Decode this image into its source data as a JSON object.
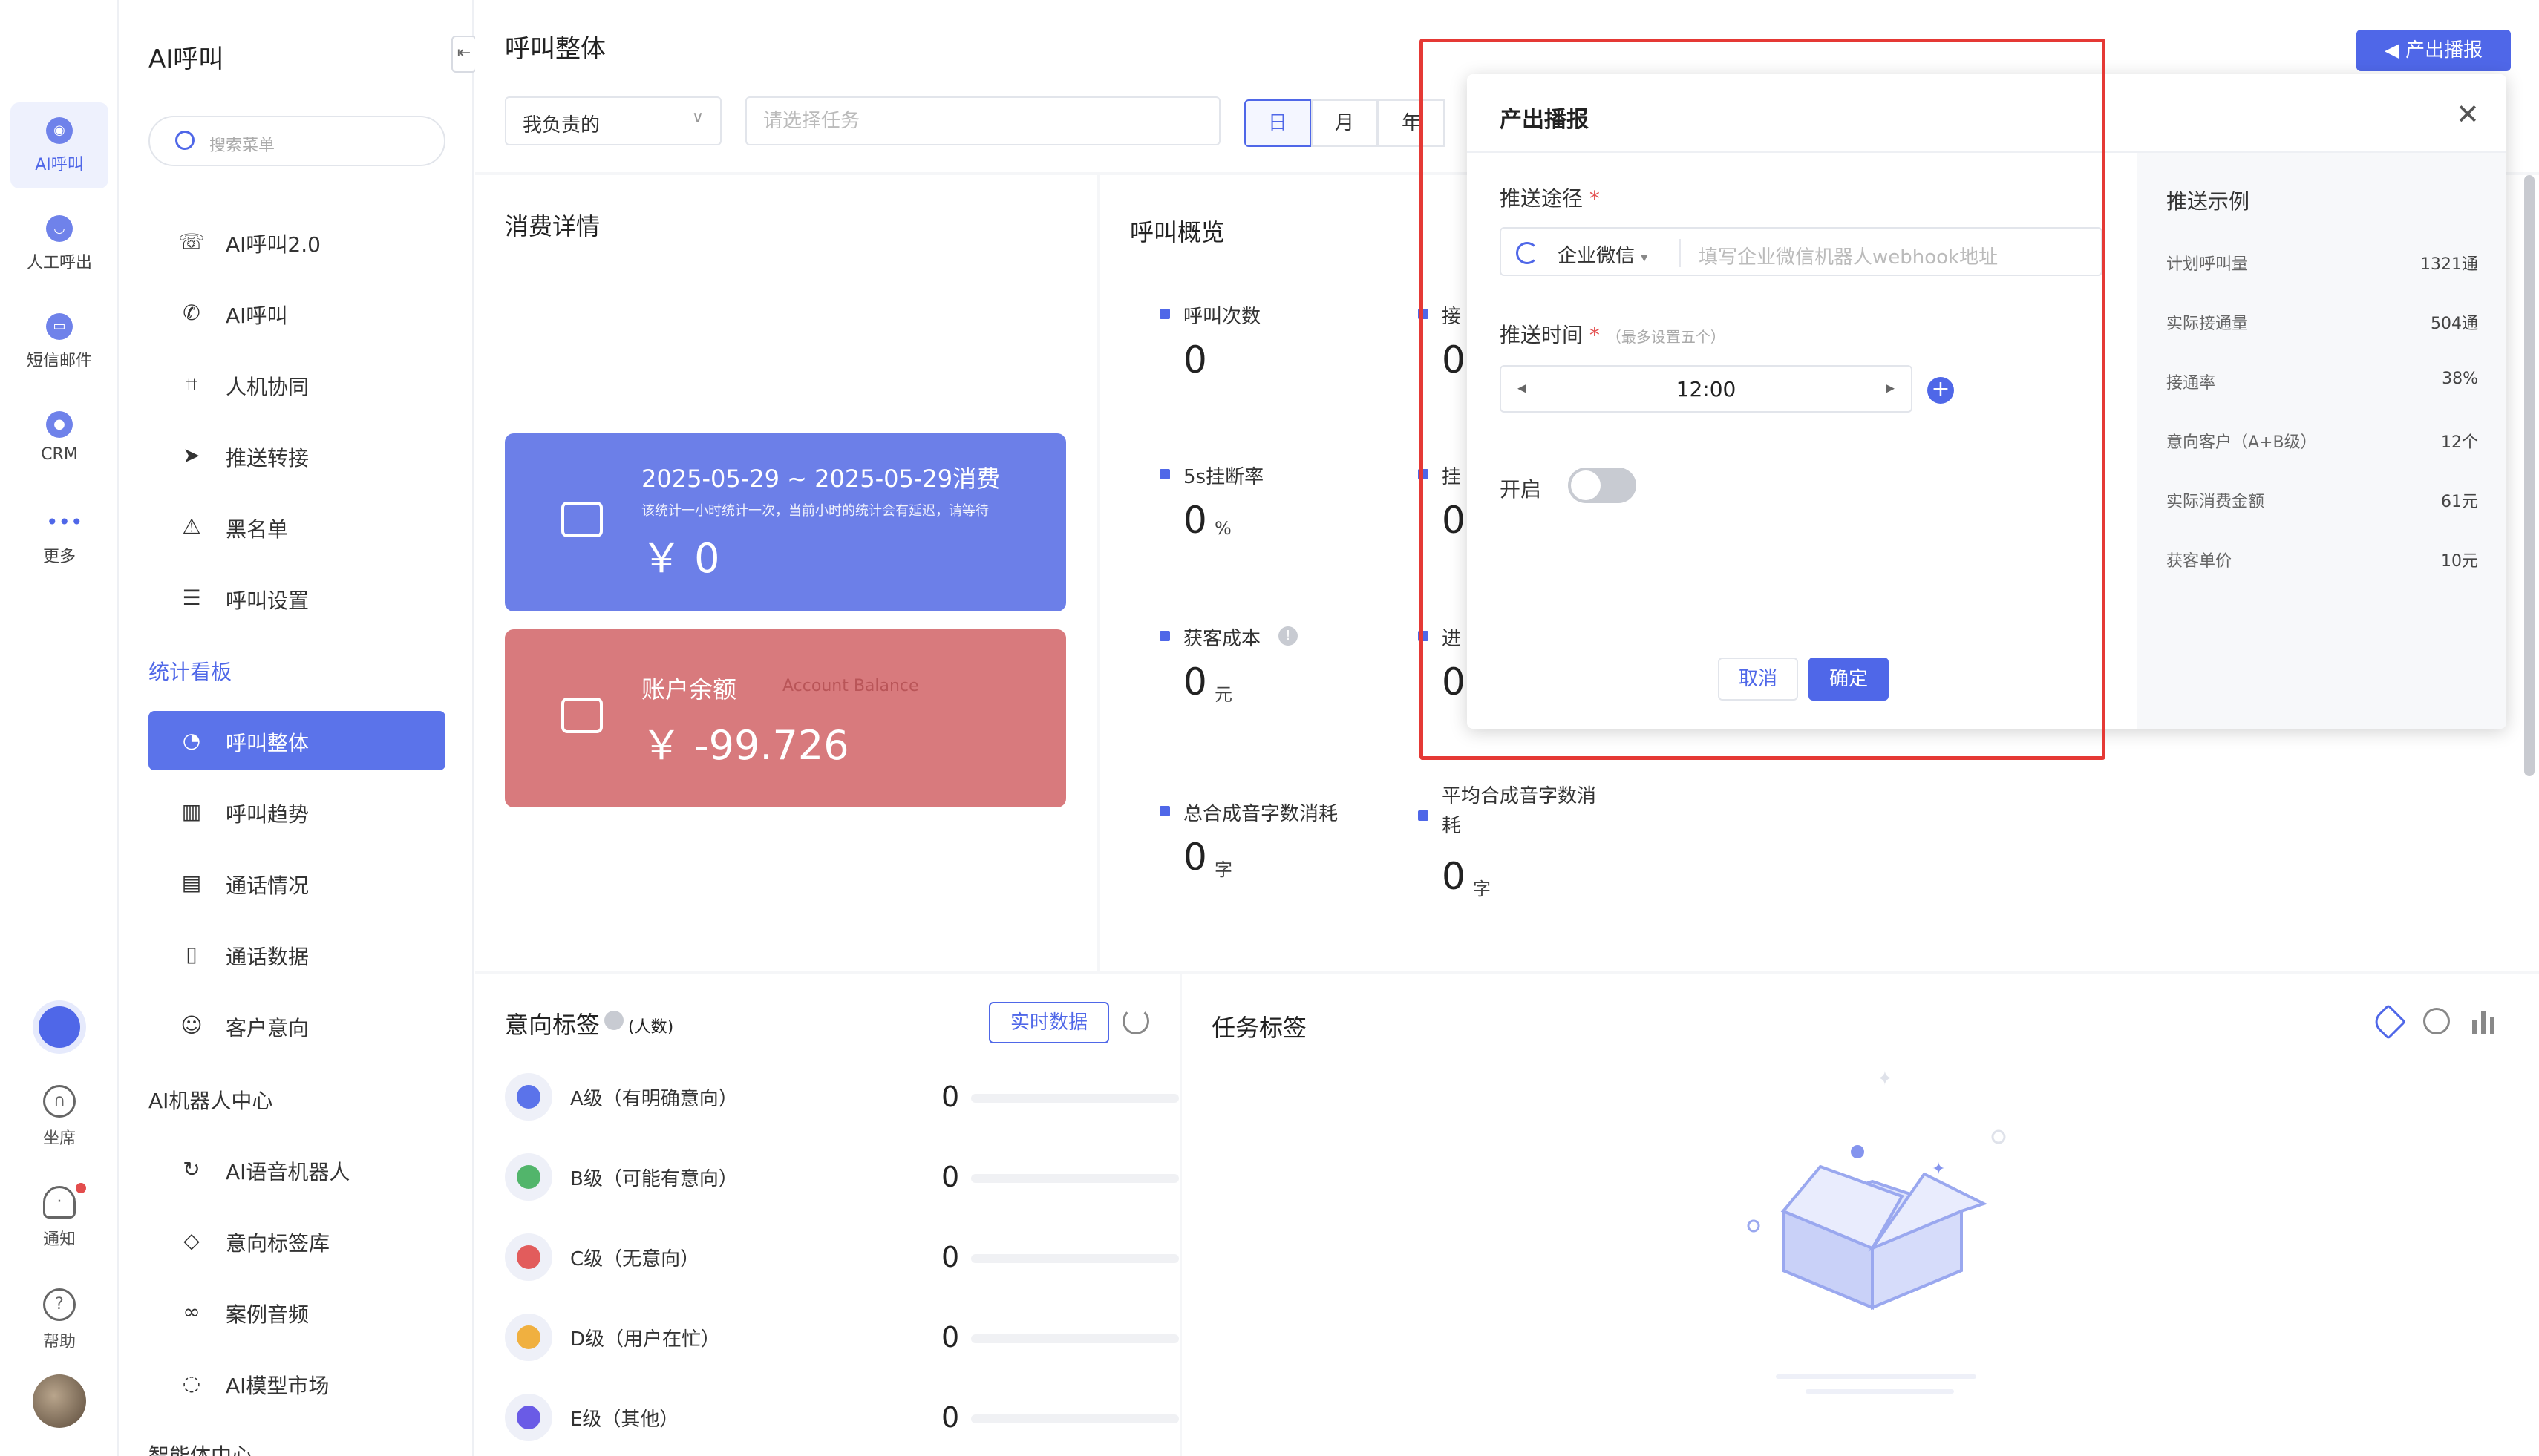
{
  "rail": {
    "items": [
      {
        "label": "AI呼叫",
        "icon": "ai-robot-icon"
      },
      {
        "label": "人工呼出",
        "icon": "phone-icon"
      },
      {
        "label": "短信邮件",
        "icon": "message-icon"
      },
      {
        "label": "CRM",
        "icon": "crm-icon"
      },
      {
        "label": "更多",
        "icon": "more-icon"
      }
    ],
    "bottom": [
      {
        "label": "坐席",
        "icon": "headset-icon"
      },
      {
        "label": "通知",
        "icon": "bell-icon"
      },
      {
        "label": "帮助",
        "icon": "help-icon"
      }
    ]
  },
  "menu": {
    "title": "AI呼叫",
    "search_placeholder": "搜索菜单",
    "group1": [
      {
        "label": "AI呼叫2.0",
        "icon": "phone-plus-icon",
        "glyph": "☏"
      },
      {
        "label": "AI呼叫",
        "icon": "phone-icon",
        "glyph": "✆"
      },
      {
        "label": "人机协同",
        "icon": "face-scan-icon",
        "glyph": "⌗"
      },
      {
        "label": "推送转接",
        "icon": "send-icon",
        "glyph": "➤"
      },
      {
        "label": "黑名单",
        "icon": "warning-icon",
        "glyph": "⚠"
      },
      {
        "label": "呼叫设置",
        "icon": "sliders-icon",
        "glyph": "☰"
      }
    ],
    "section_stats": "统计看板",
    "group2": [
      {
        "label": "呼叫整体",
        "icon": "pie-chart-icon",
        "glyph": "◔",
        "active": true
      },
      {
        "label": "呼叫趋势",
        "icon": "bar-chart-icon",
        "glyph": "▥"
      },
      {
        "label": "通话情况",
        "icon": "document-icon",
        "glyph": "▤"
      },
      {
        "label": "通话数据",
        "icon": "file-search-icon",
        "glyph": "▯"
      },
      {
        "label": "客户意向",
        "icon": "smile-icon",
        "glyph": "☺"
      }
    ],
    "section_robot": "AI机器人中心",
    "group3": [
      {
        "label": "AI语音机器人",
        "icon": "refresh-star-icon",
        "glyph": "↻"
      },
      {
        "label": "意向标签库",
        "icon": "tag-icon",
        "glyph": "◇"
      },
      {
        "label": "案例音频",
        "icon": "voicemail-icon",
        "glyph": "∞"
      },
      {
        "label": "AI模型市场",
        "icon": "chat-icon",
        "glyph": "◌"
      }
    ],
    "section_agent": "智能体中心"
  },
  "header": {
    "title": "呼叫整体",
    "broadcast_label": "产出播报",
    "owner_value": "我负责的",
    "task_placeholder": "请选择任务",
    "segments": [
      "日",
      "月",
      "年"
    ]
  },
  "consumption": {
    "title": "消费详情",
    "blue_title": "2025-05-29 ~ 2025-05-29消费",
    "blue_note": "该统计一小时统计一次，当前小时的统计会有延迟，请等待",
    "blue_value": "￥ 0",
    "red_title": "账户余额",
    "red_subtitle": "Account Balance",
    "red_value": "￥ -99.726"
  },
  "overview": {
    "title": "呼叫概览",
    "stats": [
      {
        "label": "呼叫次数",
        "value": "0",
        "unit": ""
      },
      {
        "label": "5s挂断率",
        "value": "0",
        "unit": "%"
      },
      {
        "label": "获客成本",
        "value": "0",
        "unit": "元"
      },
      {
        "label": "总合成音字数消耗",
        "value": "0",
        "unit": "字"
      }
    ],
    "stubs": [
      "接",
      "挂",
      "进"
    ],
    "avg_label_1": "平均合成音字数消",
    "avg_label_2": "耗",
    "avg_value": "0",
    "avg_unit": "字",
    "hidden_values": [
      "0",
      "0",
      "0"
    ]
  },
  "intent": {
    "title": "意向标签",
    "title_note": "(人数)",
    "realtime_label": "实时数据",
    "rows": [
      {
        "label": "A级（有明确意向）",
        "value": "0",
        "color": "#5b73ea"
      },
      {
        "label": "B级（可能有意向）",
        "value": "0",
        "color": "#52b56b"
      },
      {
        "label": "C级（无意向）",
        "value": "0",
        "color": "#e25c5c"
      },
      {
        "label": "D级（用户在忙）",
        "value": "0",
        "color": "#f0b040"
      },
      {
        "label": "E级（其他）",
        "value": "0",
        "color": "#6a5be6"
      }
    ]
  },
  "task_tags": {
    "title": "任务标签"
  },
  "modal": {
    "title": "产出播报",
    "channel_label": "推送途径",
    "channel_value": "企业微信",
    "webhook_placeholder": "填写企业微信机器人webhook地址",
    "time_label": "推送时间",
    "time_hint": "（最多设置五个）",
    "time_value": "12:00",
    "enable_label": "开启",
    "cancel_label": "取消",
    "ok_label": "确定",
    "example_title": "推送示例",
    "examples": [
      {
        "label": "计划呼叫量",
        "value": "1321通"
      },
      {
        "label": "实际接通量",
        "value": "504通"
      },
      {
        "label": "接通率",
        "value": "38%"
      },
      {
        "label": "意向客户（A+B级）",
        "value": "12个"
      },
      {
        "label": "实际消费金额",
        "value": "61元"
      },
      {
        "label": "获客单价",
        "value": "10元"
      }
    ]
  },
  "colors": {
    "accent": "#4f67e8",
    "highlight": "#e53935"
  }
}
